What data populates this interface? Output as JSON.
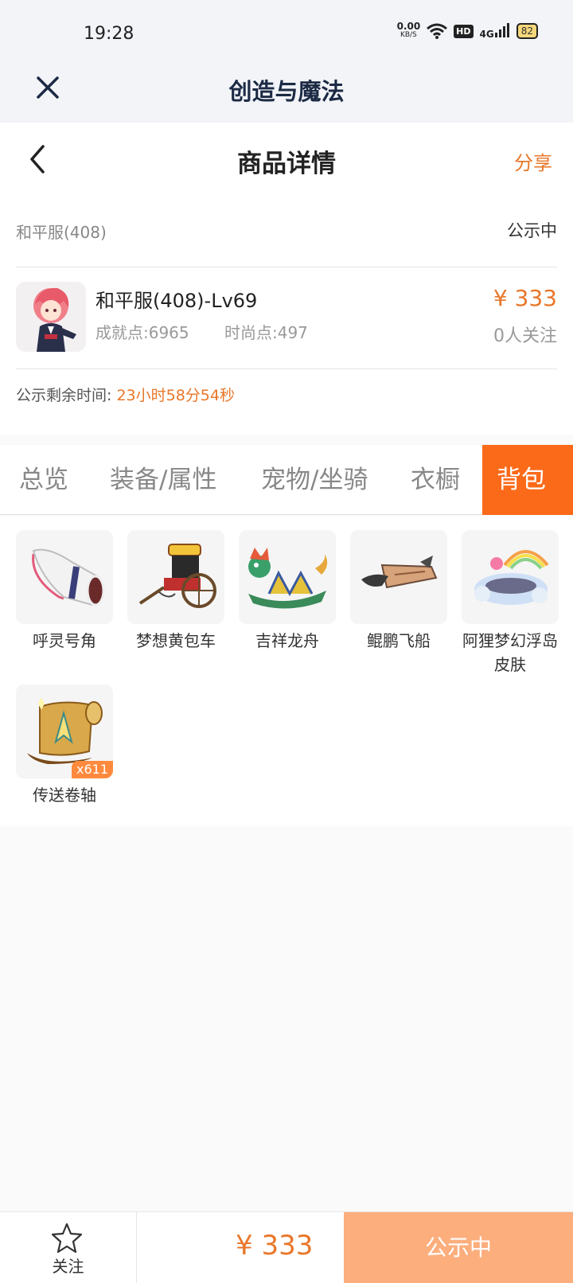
{
  "status_bar": {
    "time": "19:28",
    "net_speed": "0.00",
    "net_unit": "KB/S",
    "hd": "HD",
    "signal": "4G",
    "battery": "82"
  },
  "app": {
    "title": "创造与魔法"
  },
  "nav": {
    "title": "商品详情",
    "share": "分享"
  },
  "product": {
    "server_name": "和平服(408)",
    "listing_status": "公示中",
    "name": "和平服(408)-Lv69",
    "achievement": "成就点:6965",
    "fashion": "时尚点:497",
    "price": "¥ 333",
    "followers": "0人关注",
    "remaining_label": "公示剩余时间:",
    "remaining_time": "23小时58分54秒"
  },
  "tabs": [
    {
      "label": "总览",
      "active": false
    },
    {
      "label": "装备/属性",
      "active": false
    },
    {
      "label": "宠物/坐骑",
      "active": false
    },
    {
      "label": "衣橱",
      "active": false
    },
    {
      "label": "背包",
      "active": true
    }
  ],
  "inventory": [
    {
      "name": "呼灵号角",
      "icon": "horn-icon"
    },
    {
      "name": "梦想黄包车",
      "icon": "rickshaw-icon"
    },
    {
      "name": "吉祥龙舟",
      "icon": "dragon-boat-icon"
    },
    {
      "name": "鲲鹏飞船",
      "icon": "airship-icon"
    },
    {
      "name": "阿狸梦幻浮岛皮肤",
      "icon": "floating-island-icon"
    },
    {
      "name": "传送卷轴",
      "icon": "scroll-icon",
      "count": "x611"
    }
  ],
  "bottom": {
    "follow_label": "关注",
    "price": "¥ 333",
    "status": "公示中"
  },
  "colors": {
    "accent": "#e8772a",
    "tab_active": "#fb6a19",
    "button_disabled": "#fcae7d"
  }
}
